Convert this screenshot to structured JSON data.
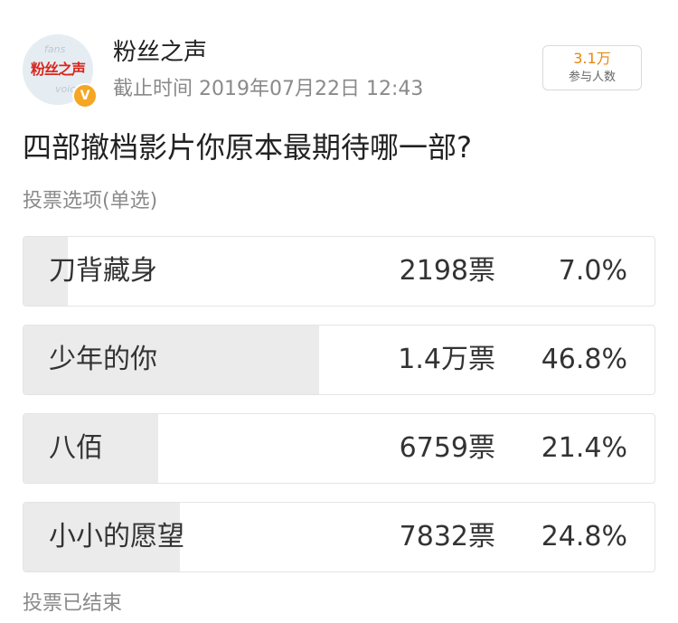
{
  "account": {
    "name": "粉丝之声",
    "avatar_text": "粉丝之声",
    "avatar_watermark_top": "fans",
    "avatar_watermark_bottom": "voice",
    "verified_badge": "V",
    "verified_icon": "verified-badge-icon"
  },
  "poll": {
    "deadline": "截止时间 2019年07月22日 12:43",
    "participants_count": "3.1万",
    "participants_label": "参与人数",
    "question": "四部撤档影片你原本最期待哪一部?",
    "vote_type": "投票选项(单选)",
    "status": "投票已结束",
    "options": [
      {
        "label": "刀背藏身",
        "votes": "2198票",
        "percent": "7.0%",
        "share": 0.07
      },
      {
        "label": "少年的你",
        "votes": "1.4万票",
        "percent": "46.8%",
        "share": 0.468
      },
      {
        "label": "八佰",
        "votes": "6759票",
        "percent": "21.4%",
        "share": 0.214
      },
      {
        "label": "小小的愿望",
        "votes": "7832票",
        "percent": "24.8%",
        "share": 0.248
      }
    ]
  },
  "colors": {
    "bar_fill": "#ebebeb",
    "participants_accent": "#e8860c",
    "logo_red": "#d9271e",
    "badge_orange": "#f5a623"
  }
}
